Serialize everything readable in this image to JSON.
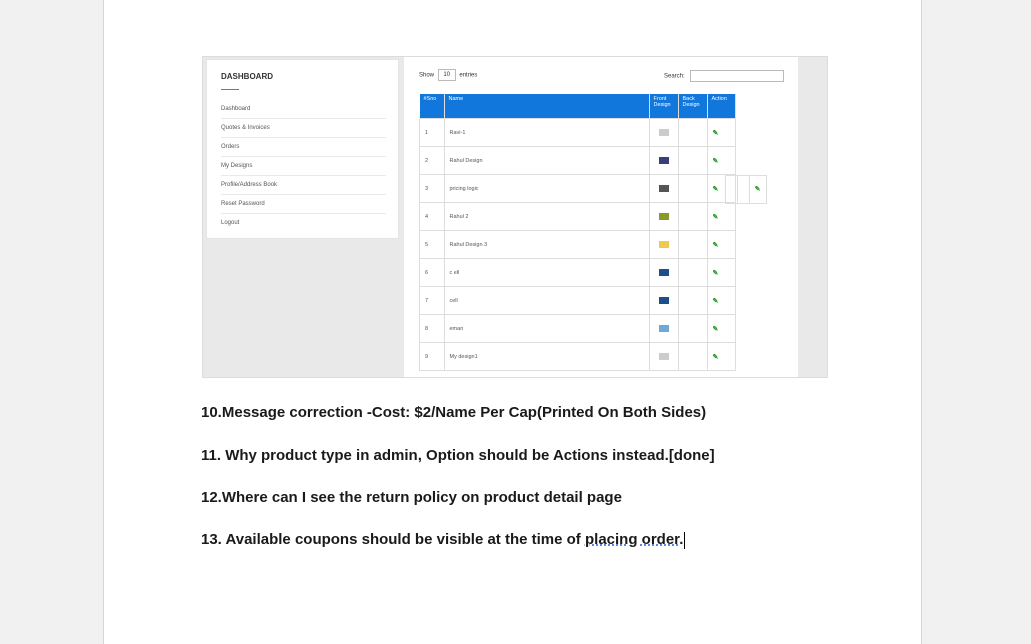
{
  "dashboard": {
    "title": "DASHBOARD",
    "menu": [
      "Dashboard",
      "Quotes & Invoices",
      "Orders",
      "My Designs",
      "Profile/Address Book",
      "Reset Password",
      "Logout"
    ],
    "show_label": "Show",
    "show_value": "10",
    "entries_label": "entries",
    "search_label": "Search:",
    "columns": [
      "#Sno",
      "Name",
      "Front Design",
      "Back Design",
      "Action"
    ],
    "rows": [
      {
        "sno": "1",
        "name": "Ravi-1",
        "thumb_color": "#cccccc",
        "action_icon": "edit-icon"
      },
      {
        "sno": "2",
        "name": "Rahul Design",
        "thumb_color": "#3a3f7a",
        "action_icon": "edit-icon"
      },
      {
        "sno": "3",
        "name": "pricing logic",
        "thumb_color": "#555555",
        "action_icon": "edit-icon"
      },
      {
        "sno": "4",
        "name": "Rahul 2",
        "thumb_color": "#8a9a2a",
        "action_icon": "edit-icon"
      },
      {
        "sno": "5",
        "name": "Rahul Design 3",
        "thumb_color": "#f2c84b",
        "action_icon": "edit-icon"
      },
      {
        "sno": "6",
        "name": "c ell",
        "thumb_color": "#1d4f8f",
        "action_icon": "edit-icon"
      },
      {
        "sno": "7",
        "name": "cell",
        "thumb_color": "#1d4f8f",
        "action_icon": "edit-icon"
      },
      {
        "sno": "8",
        "name": "eman",
        "thumb_color": "#6aaad8",
        "action_icon": "edit-icon"
      },
      {
        "sno": "9",
        "name": "My design1",
        "thumb_color": "#cccccc",
        "action_icon": "edit-icon"
      }
    ],
    "header_color": "#1177dd",
    "accent_color": "#e74c3c"
  },
  "points": [
    "10.Message correction -Cost: $2/Name Per Cap(Printed On Both Sides)",
    "11. Why product type in admin, Option should be Actions instead.[done]",
    "12.Where can I see the return policy on product detail page"
  ],
  "point13": {
    "prefix": "13. Available coupons should be visible at the time of ",
    "flagged": "placing order",
    "suffix": "."
  }
}
